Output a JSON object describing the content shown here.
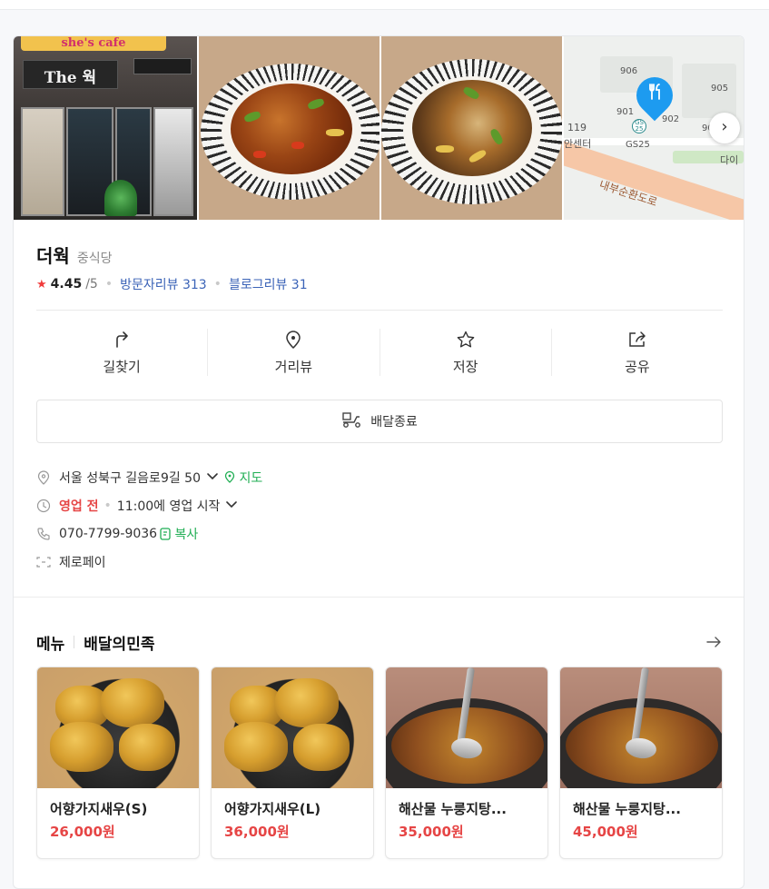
{
  "place": {
    "name": "더웍",
    "category": "중식당",
    "rating": "4.45",
    "rating_max": "/5",
    "visitor_reviews": "방문자리뷰 313",
    "blog_reviews": "블로그리뷰 31"
  },
  "photos": {
    "store_sign_top": "she's cafe",
    "store_sign_name": "The 웍"
  },
  "map": {
    "labels": [
      "906",
      "905",
      "901",
      "902",
      "903",
      "GS25",
      "119",
      "안센터",
      "다이",
      "내부순환도로"
    ],
    "gs_badge": "GS 25",
    "next_icon": "chevron-right-icon"
  },
  "actions": [
    {
      "label": "길찾기",
      "icon": "directions-icon"
    },
    {
      "label": "거리뷰",
      "icon": "location-pin-icon"
    },
    {
      "label": "저장",
      "icon": "star-icon"
    },
    {
      "label": "공유",
      "icon": "share-icon"
    }
  ],
  "delivery": {
    "label": "배달종료",
    "icon": "delivery-scooter-icon"
  },
  "details": {
    "address": "서울 성북구 길음로9길 50",
    "map_link": "지도",
    "status": "영업 전",
    "hours": "11:00에 영업 시작",
    "phone": "070-7799-9036",
    "copy": "복사",
    "payment": "제로페이"
  },
  "menu": {
    "title": "메뉴",
    "source": "배달의민족",
    "items": [
      {
        "name": "어향가지새우(S)",
        "price": "26,000원"
      },
      {
        "name": "어향가지새우(L)",
        "price": "36,000원"
      },
      {
        "name": "해산물 누룽지탕...",
        "price": "35,000원"
      },
      {
        "name": "해산물 누룽지탕...",
        "price": "45,000원"
      }
    ]
  },
  "colors": {
    "accent_red": "#e64545",
    "link_blue": "#3b63b7",
    "green": "#1fae53",
    "pin_blue": "#1d9bf0"
  }
}
